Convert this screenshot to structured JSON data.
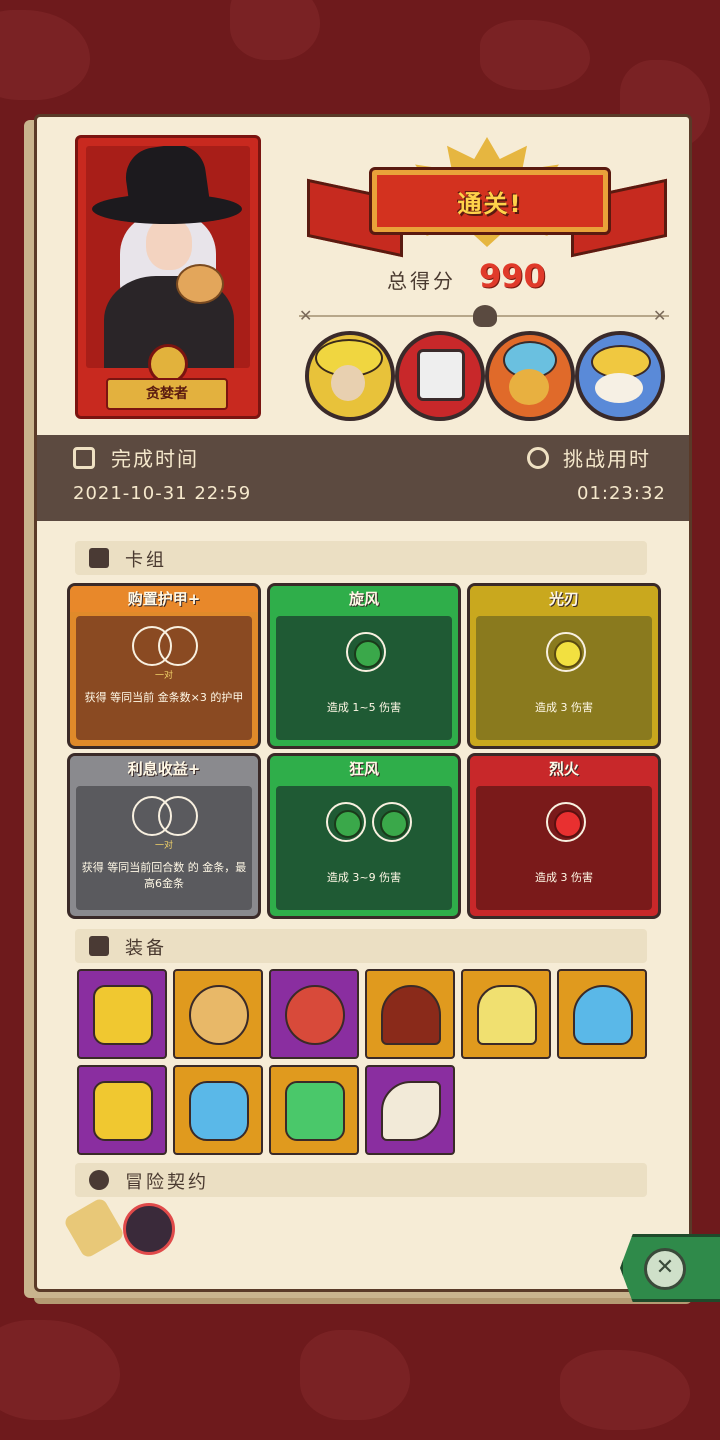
{
  "hero": {
    "name": "贪婪者"
  },
  "banner": {
    "title": "通关!"
  },
  "score": {
    "label": "总得分",
    "value": "990"
  },
  "bosses": [
    {
      "icon": "boss-straw-hat-elder-icon"
    },
    {
      "icon": "boss-cage-demon-icon"
    },
    {
      "icon": "boss-golden-beast-icon"
    },
    {
      "icon": "boss-bone-dragon-icon"
    }
  ],
  "time": {
    "finish_label": "完成时间",
    "finish_value": "2021-10-31 22:59",
    "challenge_label": "挑战用时",
    "challenge_value": "01:23:32"
  },
  "deck": {
    "title": "卡组",
    "cards": [
      {
        "name": "购置护甲+",
        "sub": "一对",
        "desc": "获得 等同当前 金条数×3 的护甲",
        "color": "#8a4a22"
      },
      {
        "name": "旋风",
        "sub": "",
        "desc": "造成 1~5 伤害",
        "color": "#1f5a34"
      },
      {
        "name": "光刃",
        "sub": "",
        "desc": "造成 3 伤害",
        "color": "#8a7a1e"
      },
      {
        "name": "利息收益+",
        "sub": "一对",
        "desc": "获得 等同当前回合数 的 金条，最高6金条",
        "color": "#5a5a5e"
      },
      {
        "name": "狂风",
        "sub": "",
        "desc": "造成 3~9 伤害",
        "color": "#1f5a34"
      },
      {
        "name": "烈火",
        "sub": "",
        "desc": "造成 3 伤害",
        "color": "#7a1a1a"
      }
    ]
  },
  "equipment": {
    "title": "装备",
    "items": [
      {
        "icon": "treasure-chest-icon",
        "bg": "#8a2ea0"
      },
      {
        "icon": "money-sack-icon",
        "bg": "#e09a1e"
      },
      {
        "icon": "spiked-bracelet-icon",
        "bg": "#8a2ea0"
      },
      {
        "icon": "hood-icon",
        "bg": "#e09a1e"
      },
      {
        "icon": "golden-goblet-icon",
        "bg": "#e09a1e"
      },
      {
        "icon": "ghost-slime-icon",
        "bg": "#e09a1e"
      },
      {
        "icon": "open-chest-icon",
        "bg": "#8a2ea0"
      },
      {
        "icon": "shield-crest-icon",
        "bg": "#e09a1e"
      },
      {
        "icon": "green-dice-icon",
        "bg": "#e09a1e"
      },
      {
        "icon": "claw-fangs-icon",
        "bg": "#8a2ea0"
      }
    ]
  },
  "contract": {
    "title": "冒险契约",
    "items": [
      {
        "icon": "scroll-icon"
      },
      {
        "icon": "red-demon-seal-icon"
      }
    ]
  }
}
